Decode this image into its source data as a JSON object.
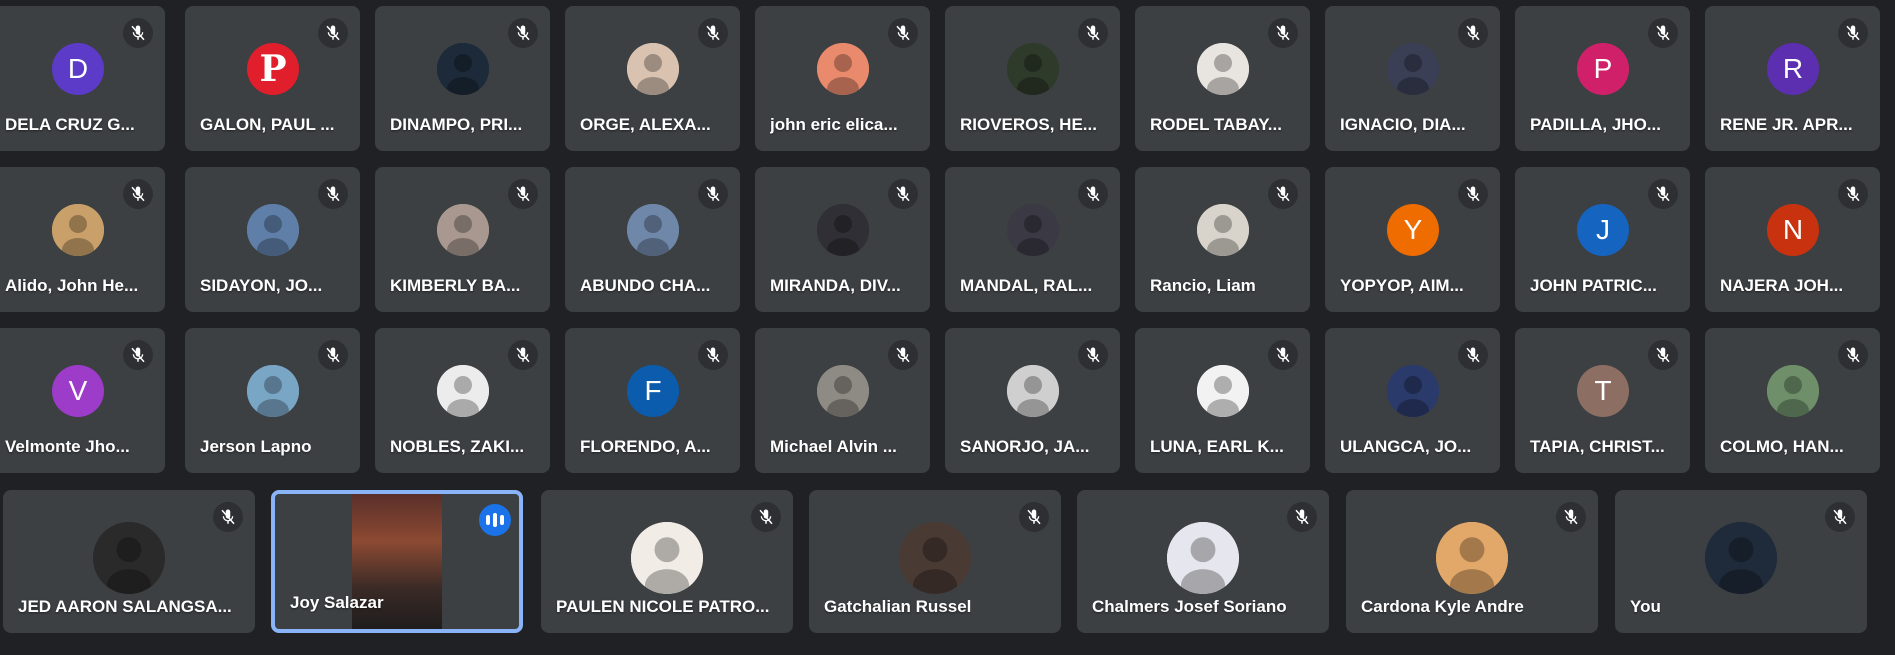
{
  "participants": [
    {
      "name": "DELA CRUZ G...",
      "initial": "D",
      "color": "#5d3bc9",
      "kind": "letter"
    },
    {
      "name": "GALON, PAUL ...",
      "initial": "P",
      "color": "#e01e2c",
      "kind": "logo"
    },
    {
      "name": "DINAMPO, PRI...",
      "initial": "",
      "color": "#1c2a3a",
      "kind": "photo"
    },
    {
      "name": "ORGE, ALEXA...",
      "initial": "",
      "color": "#d9c2b0",
      "kind": "photo"
    },
    {
      "name": "john eric elica...",
      "initial": "",
      "color": "#e98a6c",
      "kind": "photo"
    },
    {
      "name": "RIOVEROS, HE...",
      "initial": "",
      "color": "#2e3a2a",
      "kind": "photo"
    },
    {
      "name": "RODEL TABAY...",
      "initial": "",
      "color": "#e8e4e0",
      "kind": "photo"
    },
    {
      "name": "IGNACIO, DIA...",
      "initial": "",
      "color": "#3a3f55",
      "kind": "photo"
    },
    {
      "name": "PADILLA, JHO...",
      "initial": "P",
      "color": "#d1206a",
      "kind": "letter"
    },
    {
      "name": "RENE JR. APR...",
      "initial": "R",
      "color": "#5b2fb0",
      "kind": "letter"
    },
    {
      "name": "Alido, John He...",
      "initial": "",
      "color": "#c9a06a",
      "kind": "photo"
    },
    {
      "name": "SIDAYON, JO...",
      "initial": "",
      "color": "#5f7ea8",
      "kind": "photo"
    },
    {
      "name": "KIMBERLY BA...",
      "initial": "",
      "color": "#a89890",
      "kind": "photo"
    },
    {
      "name": "ABUNDO CHA...",
      "initial": "",
      "color": "#6f87a8",
      "kind": "photo"
    },
    {
      "name": "MIRANDA, DIV...",
      "initial": "",
      "color": "#2f2f35",
      "kind": "photo"
    },
    {
      "name": "MANDAL, RAL...",
      "initial": "",
      "color": "#3b3a44",
      "kind": "photo"
    },
    {
      "name": "Rancio, Liam",
      "initial": "",
      "color": "#d8d4cc",
      "kind": "photo"
    },
    {
      "name": "YOPYOP, AIM...",
      "initial": "Y",
      "color": "#ef6c00",
      "kind": "letter"
    },
    {
      "name": "JOHN PATRIC...",
      "initial": "J",
      "color": "#1565c0",
      "kind": "letter"
    },
    {
      "name": "NAJERA JOH...",
      "initial": "N",
      "color": "#c8320f",
      "kind": "letter"
    },
    {
      "name": "Velmonte Jho...",
      "initial": "V",
      "color": "#9c3cc9",
      "kind": "letter"
    },
    {
      "name": "Jerson Lapno",
      "initial": "",
      "color": "#7aa6c6",
      "kind": "photo"
    },
    {
      "name": "NOBLES, ZAKI...",
      "initial": "",
      "color": "#ececec",
      "kind": "photo"
    },
    {
      "name": "FLORENDO, A...",
      "initial": "F",
      "color": "#0b5cad",
      "kind": "letter"
    },
    {
      "name": "Michael Alvin ...",
      "initial": "",
      "color": "#8e8a84",
      "kind": "photo"
    },
    {
      "name": "SANORJO, JA...",
      "initial": "",
      "color": "#cfcfcf",
      "kind": "photo"
    },
    {
      "name": "LUNA, EARL K...",
      "initial": "",
      "color": "#f2f2f2",
      "kind": "photo"
    },
    {
      "name": "ULANGCA, JO...",
      "initial": "",
      "color": "#2a3a6a",
      "kind": "photo"
    },
    {
      "name": "TAPIA, CHRIST...",
      "initial": "T",
      "color": "#8d6e63",
      "kind": "letter"
    },
    {
      "name": "COLMO, HAN...",
      "initial": "",
      "color": "#6e8f6a",
      "kind": "photo"
    }
  ],
  "bottom_row": [
    {
      "name": "JED AARON SALANGSA...",
      "color": "#2a2a2a",
      "speaking": false,
      "muted": true
    },
    {
      "name": "Joy Salazar",
      "color": "#5a2f2a",
      "speaking": true,
      "muted": false
    },
    {
      "name": "PAULEN NICOLE PATRO...",
      "color": "#f2ece6",
      "speaking": false,
      "muted": true
    },
    {
      "name": "Gatchalian Russel",
      "color": "#4a3a34",
      "speaking": false,
      "muted": true
    },
    {
      "name": "Chalmers Josef Soriano",
      "color": "#e6e6ee",
      "speaking": false,
      "muted": true
    },
    {
      "name": "Cardona Kyle Andre",
      "color": "#e2a86a",
      "speaking": false,
      "muted": true
    },
    {
      "name": "You",
      "color": "#1f2a3a",
      "speaking": false,
      "muted": true
    }
  ],
  "icons": {
    "muted": "mic-off-icon",
    "speaking": "audio-level-icon"
  },
  "colors": {
    "background": "#202124",
    "tile": "#3c4043",
    "active_border": "#8ab4f8"
  }
}
